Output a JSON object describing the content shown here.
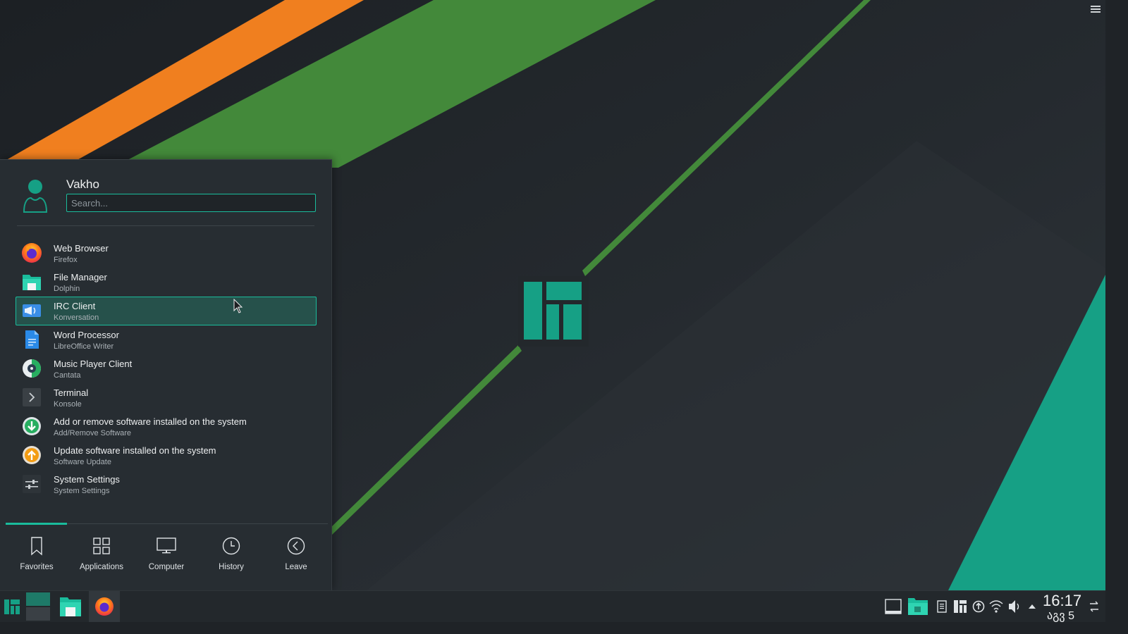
{
  "desktop": {
    "menu_icon": "hamburger-menu-icon"
  },
  "launcher": {
    "user_name": "Vakho",
    "search_placeholder": "Search...",
    "favorites": [
      {
        "title": "Web Browser",
        "subtitle": "Firefox",
        "icon": "firefox-icon"
      },
      {
        "title": "File Manager",
        "subtitle": "Dolphin",
        "icon": "folder-icon"
      },
      {
        "title": "IRC Client",
        "subtitle": "Konversation",
        "icon": "megaphone-icon"
      },
      {
        "title": "Word Processor",
        "subtitle": "LibreOffice Writer",
        "icon": "document-icon"
      },
      {
        "title": "Music Player Client",
        "subtitle": "Cantata",
        "icon": "music-icon"
      },
      {
        "title": "Terminal",
        "subtitle": "Konsole",
        "icon": "terminal-icon"
      },
      {
        "title": "Add or remove software installed on the system",
        "subtitle": "Add/Remove Software",
        "icon": "download-icon"
      },
      {
        "title": "Update software installed on the system",
        "subtitle": "Software Update",
        "icon": "upload-icon"
      },
      {
        "title": "System Settings",
        "subtitle": "System Settings",
        "icon": "settings-sliders-icon"
      }
    ],
    "tabs": [
      {
        "label": "Favorites",
        "icon": "bookmark-icon"
      },
      {
        "label": "Applications",
        "icon": "grid-icon"
      },
      {
        "label": "Computer",
        "icon": "monitor-icon"
      },
      {
        "label": "History",
        "icon": "clock-icon"
      },
      {
        "label": "Leave",
        "icon": "back-circle-icon"
      }
    ]
  },
  "taskbar": {
    "clock_time": "16:17",
    "clock_date": "აგვ 5"
  },
  "colors": {
    "accent": "#1abc9c",
    "orange": "#f07f1f",
    "green": "#43893a"
  }
}
